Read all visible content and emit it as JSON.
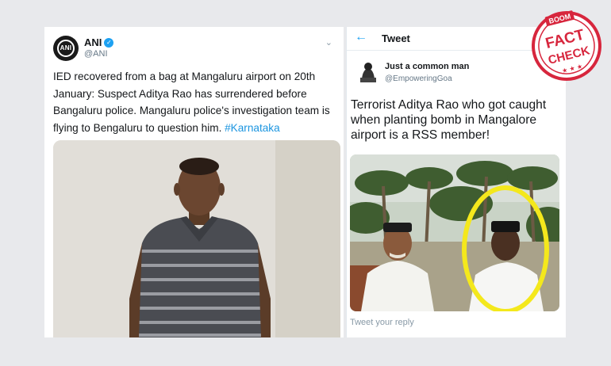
{
  "left_tweet": {
    "name": "ANI",
    "handle": "@ANI",
    "avatar_text": "ANI",
    "text_main": "IED recovered from a bag at Mangaluru airport on 20th January: Suspect Aditya Rao has surrendered before Bangaluru police. Mangaluru police's investigation team is flying to Bengaluru to question him.",
    "hashtag": "#Karnataka"
  },
  "right_tweet": {
    "header_title": "Tweet",
    "user_name": "Just a common man",
    "user_handle": "@EmpoweringGoa",
    "text": "Terrorist Aditya Rao who got caught when planting bomb in Mangalore airport is a RSS member!",
    "reply_placeholder": "Tweet your reply"
  },
  "stamp": {
    "brand": "BOOM",
    "line1": "FACT",
    "line2": "CHECK"
  },
  "colors": {
    "accent_blue": "#1da1f2",
    "hashtag_blue": "#1b95e0",
    "stamp_red": "#d7263d",
    "highlight_yellow": "#f4e81c"
  },
  "icons": [
    "verified-badge-icon",
    "chevron-down-icon",
    "back-arrow-icon"
  ]
}
